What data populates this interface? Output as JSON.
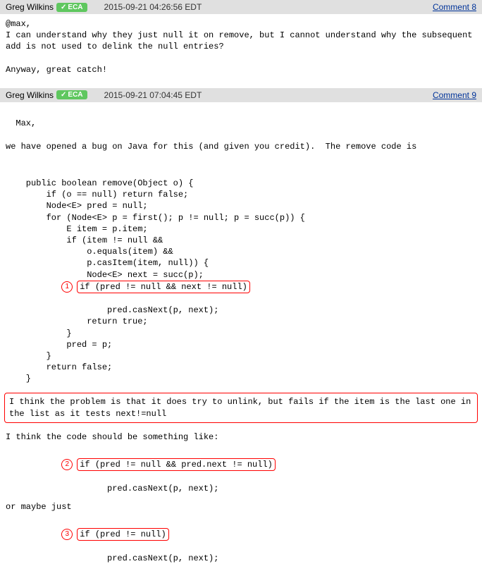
{
  "comments": [
    {
      "author": "Greg Wilkins",
      "badge": "ECA",
      "timestamp": "2015-09-21 04:26:56 EDT",
      "link": "Comment 8",
      "body": "@max,\nI can understand why they just null it on remove, but I cannot understand why the subsequent add is not used to delink the null entries?\n\nAnyway, great catch!"
    },
    {
      "author": "Greg Wilkins",
      "badge": "ECA",
      "timestamp": "2015-09-21 07:04:45 EDT",
      "link": "Comment 9",
      "intro": "Max,\n\nwe have opened a bug on Java for this (and given you credit).  The remove code is\n",
      "code_pre": "    public boolean remove(Object o) {\n        if (o == null) return false;\n        Node<E> pred = null;\n        for (Node<E> p = first(); p != null; p = succ(p)) {\n            E item = p.item;\n            if (item != null &&\n                o.equals(item) &&\n                p.casItem(item, null)) {\n                Node<E> next = succ(p);",
      "annot1": "if (pred != null && next != null)",
      "code_post1": "                    pred.casNext(p, next);\n                return true;\n            }\n            pred = p;\n        }\n        return false;\n    }",
      "annot_para": "I think the problem is that it does try to unlink, but fails if the item is the last one in the list as it tests next!=null",
      "mid_text": "I think the code should be something like:",
      "annot2": "if (pred != null && pred.next != null)",
      "code_post2": "                    pred.casNext(p, next);",
      "mid_text2": "or maybe just",
      "annot3": "if (pred != null)",
      "code_post3": "                    pred.casNext(p, next);"
    }
  ],
  "annotations": {
    "n1": "1",
    "n2": "2",
    "n3": "3"
  }
}
